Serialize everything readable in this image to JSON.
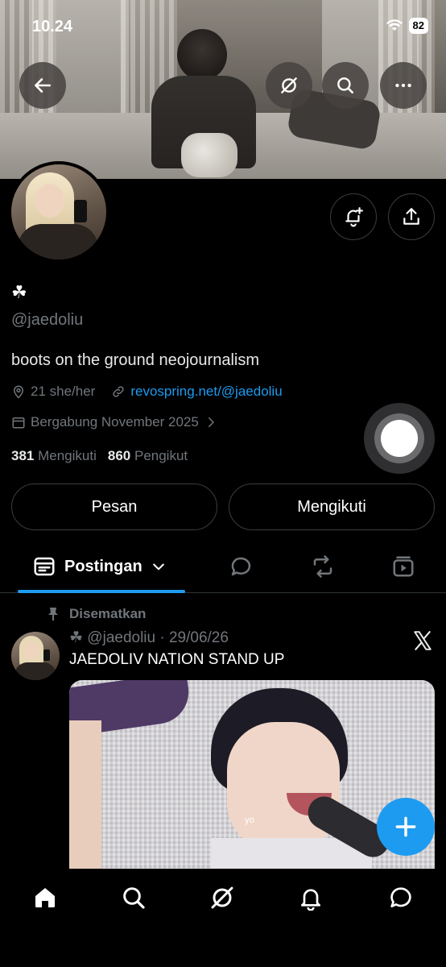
{
  "status_bar": {
    "time": "10.24",
    "battery": "82"
  },
  "profile": {
    "display_name": "☘",
    "handle": "@jaedoliu",
    "bio": "boots on the ground neojournalism",
    "location": "21 she/her",
    "website": "revospring.net/@jaedoliu",
    "joined": "Bergabung November 2025",
    "following_count": "381",
    "following_label": "Mengikuti",
    "followers_count": "860",
    "followers_label": "Pengikut"
  },
  "actions": {
    "message_label": "Pesan",
    "following_button_label": "Mengikuti"
  },
  "tabs": {
    "posts_label": "Postingan"
  },
  "pinned_post": {
    "pinned_label": "Disematkan",
    "header": "☘ @jaedoliu · 29/06/26",
    "text": "JAEDOLIV NATION STAND UP",
    "media_caption": "yo"
  },
  "colors": {
    "accent": "#1d9bf0",
    "background": "#000000",
    "muted_text": "#71767b"
  },
  "icons": {
    "header_buttons": [
      "back-arrow-icon",
      "grok-icon",
      "search-icon",
      "more-icon"
    ],
    "profile_buttons": [
      "notification-bell-plus-icon",
      "share-icon"
    ],
    "tabs": [
      "posts-icon",
      "replies-icon",
      "reposts-icon",
      "media-icon"
    ],
    "bottom_nav": [
      "home-icon",
      "search-icon",
      "grok-icon",
      "notifications-icon",
      "messages-icon"
    ]
  }
}
